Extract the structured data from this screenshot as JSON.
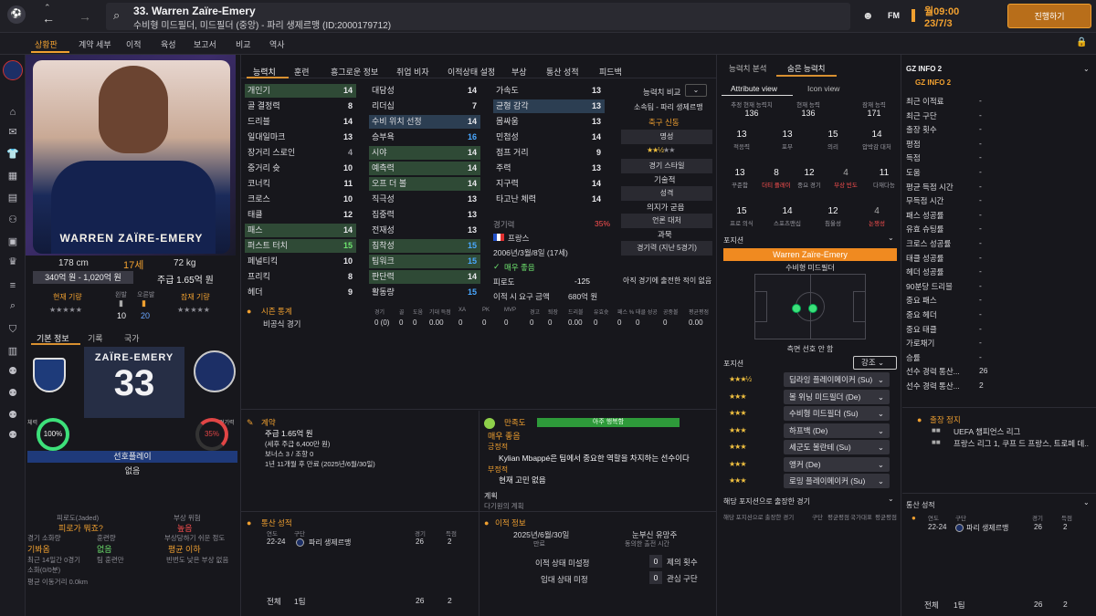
{
  "header": {
    "title": "33. Warren Zaïre-Emery",
    "subtitle": "수비형 미드필더, 미드필더 (중앙) - 파리 생제르맹 (ID:2000179712)",
    "fm_label": "FM",
    "time": "월09:00",
    "date": "23/7/3",
    "continue_label": "진행하기"
  },
  "nav": {
    "items": [
      "상황판",
      "계약 세부",
      "이적",
      "육성",
      "보고서",
      "비교",
      "역사"
    ]
  },
  "player": {
    "height": "178 cm",
    "age": "17세",
    "weight": "72 kg",
    "value": "340억 원 - 1,020억 원",
    "wage": "주급 1.65억 원",
    "current_ability_label": "현재 기량",
    "potential_ability_label": "잠재 기량",
    "foot_left_label": "왼발",
    "foot_left": "10",
    "foot_right_label": "오른발",
    "foot_right": "20",
    "card_name": "WARREN ZAÏRE-EMERY"
  },
  "tabs_left": [
    "기본 정보",
    "기록",
    "국가"
  ],
  "shirt": {
    "name": "ZAÏRE-EMERY",
    "number": "33"
  },
  "gauges": {
    "fitness_label": "체력",
    "fitness": "100%",
    "match_label": "경기력",
    "match": "35%"
  },
  "preferred": {
    "label": "선호플레이",
    "value": "없음"
  },
  "left_bottom": {
    "fatigue_label": "피로도(Jaded)",
    "fatigue_value": "피로가 뭐죠?",
    "injury_label": "부상 위험",
    "injury_value": "높음",
    "minutes_label": "경기 소화량",
    "minutes_value": "기봐옴",
    "training_label": "훈련량",
    "training_value": "없음",
    "injury_prone_label": "부상당하기 쉬운 정도",
    "injury_prone_value": "평균 이하",
    "recent_label": "최근 14일간 0경기",
    "recent_value": "소화(0/0분)",
    "training_team": "팀 훈련만",
    "history_label": "빈번도 낮은 부상 없음",
    "avg_dist": "평균 이동거리 0.0km"
  },
  "attr_tabs": [
    "능력치",
    "훈련",
    "흥그로운 정보",
    "취업 비자",
    "이적상태 설정",
    "부상",
    "통산 성적",
    "피드백"
  ],
  "attributes": {
    "col1": [
      [
        "개인기",
        "14"
      ],
      [
        "골 결정력",
        "8"
      ],
      [
        "드리블",
        "14"
      ],
      [
        "일대일마크",
        "13"
      ],
      [
        "장거리 스로인",
        "4"
      ],
      [
        "중거리 슛",
        "10"
      ],
      [
        "코너킥",
        "11"
      ],
      [
        "크로스",
        "10"
      ],
      [
        "태클",
        "12"
      ],
      [
        "패스",
        "14"
      ],
      [
        "퍼스트 터치",
        "15"
      ],
      [
        "페널티킥",
        "10"
      ],
      [
        "프리킥",
        "8"
      ],
      [
        "헤더",
        "9"
      ]
    ],
    "col2": [
      [
        "대담성",
        "14"
      ],
      [
        "리더십",
        "7"
      ],
      [
        "수비 위치 선정",
        "14"
      ],
      [
        "승부욕",
        "16"
      ],
      [
        "시야",
        "14"
      ],
      [
        "예측력",
        "14"
      ],
      [
        "오프 더 볼",
        "14"
      ],
      [
        "직극성",
        "13"
      ],
      [
        "집중력",
        "13"
      ],
      [
        "전재성",
        "13"
      ],
      [
        "침착성",
        "15"
      ],
      [
        "팀워크",
        "15"
      ],
      [
        "판단력",
        "14"
      ],
      [
        "활동량",
        "15"
      ]
    ],
    "col3": [
      [
        "가속도",
        "13"
      ],
      [
        "균형 감각",
        "13"
      ],
      [
        "몸싸움",
        "13"
      ],
      [
        "민첩성",
        "14"
      ],
      [
        "점프 거리",
        "9"
      ],
      [
        "주력",
        "13"
      ],
      [
        "지구력",
        "14"
      ],
      [
        "타고난 체력",
        "14"
      ]
    ]
  },
  "mid_info": {
    "match_label": "경기력",
    "match_value": "35%",
    "nation": "프랑스",
    "birth": "2006년/3월/8일 (17세)",
    "morale_label": "매우 좋음",
    "fatigue_label": "피로도",
    "fatigue_value": "-125",
    "transfer_label": "이적 시 요구 금액",
    "transfer_value": "680억 원"
  },
  "compare": {
    "title": "능력치 비교",
    "club_label": "소속팀 - 파리 생제르맹",
    "fame": "축구 신동",
    "rep_label": "명성",
    "style_label": "경기 스타일",
    "tech_label": "기술적",
    "personality_label": "성격",
    "personality_value": "의지가 굳음",
    "media_label": "언론 대처",
    "media_value": "과묵",
    "last5_label": "경기력 (지난 5경기)",
    "last5_value": "아직 경기에 출전한 적이 없음"
  },
  "season": {
    "title": "시즌 통계",
    "headers": [
      "경기",
      "골",
      "도움",
      "기대 득점",
      "XA",
      "PK",
      "MVP",
      "경고",
      "퇴장",
      "드리블",
      "유효슛",
      "패스 %",
      "태클 성공",
      "공중볼",
      "평균평점"
    ],
    "row_label": "비공식 경기",
    "row_values": [
      "0 (0)",
      "0",
      "0",
      "0.00",
      "0",
      "0",
      "0",
      "0",
      "0",
      "0.00",
      "0",
      "0",
      "0",
      "0",
      "0.00"
    ]
  },
  "contract": {
    "title": "계약",
    "wage": "주급 1.65억 원",
    "detail": "(세후 주급 6,400만 원)",
    "bonus": "보너스 3 / 조항 0",
    "expiry": "1년 11개월 후 만료 (2025년/6월/30일)"
  },
  "satisfaction": {
    "title": "만족도",
    "bar": "아주 행복함",
    "level": "매우 좋음",
    "pos_title": "긍정적",
    "pos_text": "Kylian Mbappé은 팀에서 중요한 역할을 차지하는 선수이다",
    "neg_title": "부정적",
    "neg_text": "현재 고민 없음",
    "plan_title": "계획",
    "plan_text": "다기원의 계획"
  },
  "career": {
    "title": "통산 성적",
    "headers": [
      "연도",
      "구단",
      "경기",
      "득점"
    ],
    "season": "22-24",
    "club": "파리 생제르맹",
    "apps": "26",
    "goals": "2",
    "total_label": "전체",
    "total_team": "1팀",
    "total_apps": "26",
    "total_goals": "2"
  },
  "transfer_info": {
    "title": "이적 정보",
    "date": "2025년/6월/30일",
    "date_sub": "만료",
    "release_label": "눈부신 유망주",
    "release_sub": "동의한 출전 시간",
    "status1": "이적 상태 미설정",
    "status2": "임대 상태 미정",
    "count1": "0",
    "count1_label": "제의 횟수",
    "count2": "0",
    "count2_label": "관심 구단"
  },
  "analysis": {
    "tabs": [
      "능력치 분석",
      "숨은 능력치"
    ],
    "subtabs": [
      "Attribute view",
      "Icon view"
    ],
    "kpis": [
      [
        "추정 현재 능력치",
        "136"
      ],
      [
        "현재 능력",
        "136"
      ],
      [
        "잠재 능력",
        "171"
      ]
    ],
    "hidden_row1": [
      [
        "13",
        "적응력"
      ],
      [
        "13",
        "포부"
      ],
      [
        "15",
        "의리"
      ],
      [
        "14",
        "압박감 대처"
      ]
    ],
    "hidden_row2": [
      [
        "13",
        "꾸준함"
      ],
      [
        "8",
        "더티 플레이"
      ],
      [
        "12",
        "중요 경기"
      ],
      [
        "4",
        "부상 빈도"
      ],
      [
        "11",
        "다재다능"
      ]
    ],
    "hidden_row3": [
      [
        "15",
        "프로 의식"
      ],
      [
        "14",
        "스포츠맨십"
      ],
      [
        "12",
        "침울성"
      ],
      [
        "4",
        "논쟁성"
      ]
    ]
  },
  "position": {
    "title": "포지션",
    "name": "Warren Zaïre-Emery",
    "role": "수비형 미드필더",
    "footer": "측면 선호 안 함",
    "roles_title": "포지션",
    "sort_label": "강조",
    "roles": [
      [
        "딥라잉 플레이메이커 (Su)",
        "★★★½"
      ],
      [
        "볼 위닝 미드필더 (De)",
        "★★★"
      ],
      [
        "수비형 미드필더 (Su)",
        "★★★"
      ],
      [
        "하프백 (De)",
        "★★★"
      ],
      [
        "세군도 볼란테 (Su)",
        "★★★"
      ],
      [
        "앵커 (De)",
        "★★★"
      ],
      [
        "로밍 플레이메이커 (Su)",
        "★★★"
      ]
    ],
    "played_title": "해당 포지션으로 출장한 경기",
    "played_cols": [
      "해당 포지션으로 출장한 경기",
      "구단",
      "평균평점",
      "국가대표",
      "평균평점"
    ]
  },
  "gz": {
    "title": "GZ INFO 2",
    "link": "GZ INFO 2",
    "rows": [
      [
        "최근 이적료",
        "-"
      ],
      [
        "최근 구단",
        "-"
      ],
      [
        "출장 횟수",
        "-"
      ],
      [
        "평점",
        "-"
      ],
      [
        "득점",
        "-"
      ],
      [
        "도움",
        "-"
      ],
      [
        "평균 득점 시간",
        "-"
      ],
      [
        "무득점 시간",
        "-"
      ],
      [
        "패스 성공률",
        "-"
      ],
      [
        "유효 슈팅률",
        "-"
      ],
      [
        "크로스 성공률",
        "-"
      ],
      [
        "태클 성공률",
        "-"
      ],
      [
        "헤더 성공률",
        "-"
      ],
      [
        "90분당 드리블",
        "-"
      ],
      [
        "중요 패스",
        "-"
      ],
      [
        "중요 헤더",
        "-"
      ],
      [
        "중요 태클",
        "-"
      ],
      [
        "가로채기",
        "-"
      ],
      [
        "승률",
        "-"
      ],
      [
        "선수 경력 통산...",
        "26"
      ],
      [
        "선수 경력 통산...",
        "2"
      ]
    ],
    "suspension_title": "출장 정지",
    "susp1": "UEFA 챔피언스 리그",
    "susp2": "프랑스 리그 1, 쿠프 드 프랑스, 트로페 데...",
    "career_title": "통산 성적",
    "career_headers": [
      "연도",
      "구단",
      "경기",
      "득점"
    ],
    "season": "22-24",
    "club": "파리 생제르맹",
    "apps": "26",
    "goals": "2",
    "total_label": "전체",
    "total_team": "1팀",
    "total_apps": "26",
    "total_goals": "2"
  }
}
